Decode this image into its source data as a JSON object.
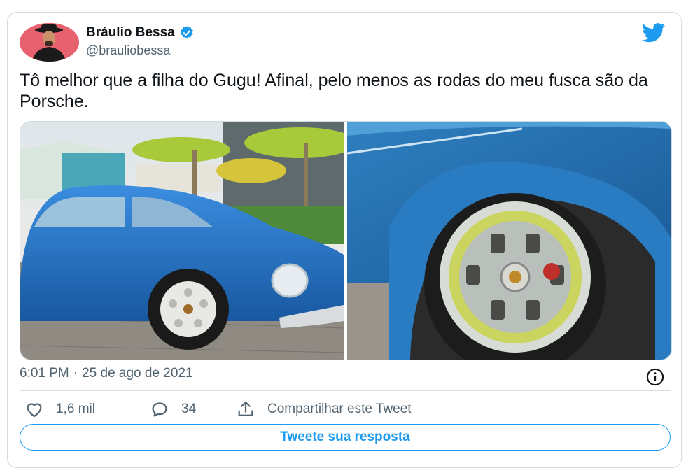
{
  "author": {
    "name": "Bráulio Bessa",
    "handle": "@brauliobessa"
  },
  "tweet": {
    "text": "Tô melhor que a filha do Gugu! Afinal, pelo menos as rodas do meu fusca são da Porsche.",
    "time": "6:01 PM",
    "separator": "·",
    "date": "25 de ago de 2021"
  },
  "actions": {
    "likes": "1,6 mil",
    "replies": "34",
    "share_label": "Compartilhar este Tweet"
  },
  "reply_button_label": "Tweete sua resposta",
  "colors": {
    "accent": "#1d9bf0",
    "verified": "#1d9bf0",
    "avatar_bg": "#e8616e",
    "car_blue": "#1f6fb8"
  },
  "icons": [
    "verified-badge-icon",
    "twitter-bird-icon",
    "info-icon",
    "heart-icon",
    "comment-icon",
    "share-icon"
  ]
}
